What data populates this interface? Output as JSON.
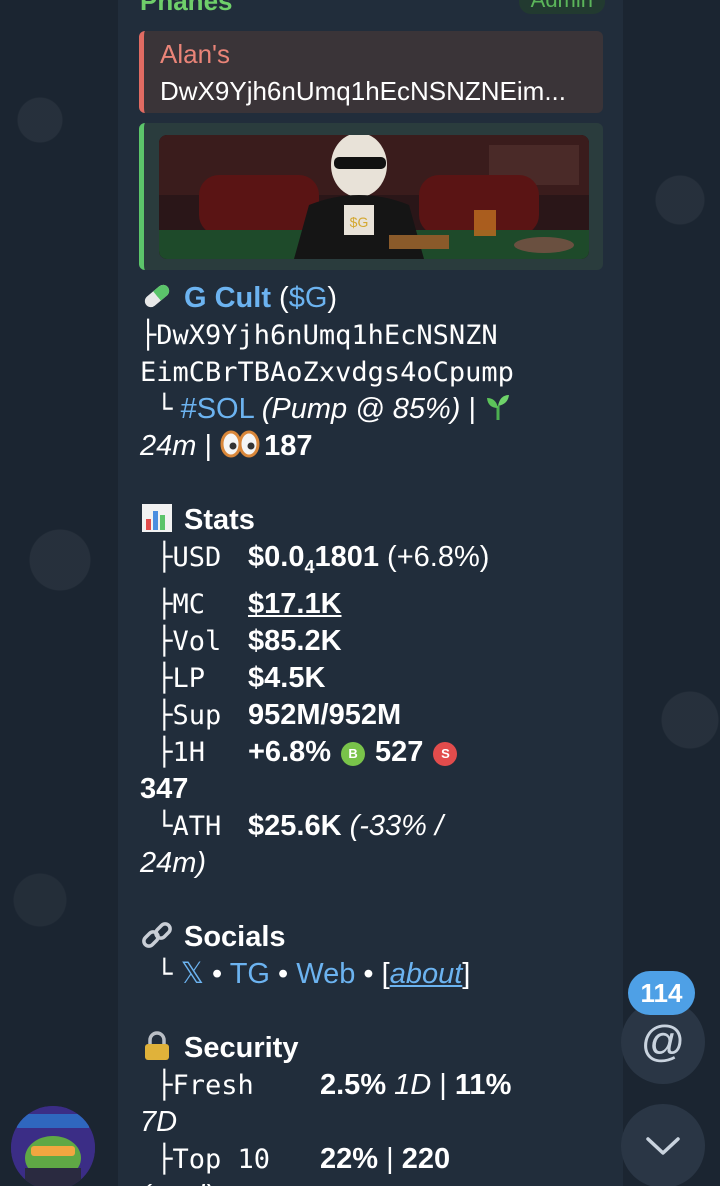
{
  "sender": {
    "name": "Phanes",
    "badge": "Admin"
  },
  "reply": {
    "name": "Alan's",
    "text": "DwX9Yjh6nUmq1hEcNSNZNEim..."
  },
  "token": {
    "name": "G Cult",
    "ticker": "$G",
    "ca_line1": "DwX9Yjh6nUmq1hEcNSNZN",
    "ca_line2": "EimCBrTBAoZxvdgs4oCpump",
    "chain": "#SOL",
    "pump_info": "(Pump @ 85%)",
    "age": "24m",
    "views": "187"
  },
  "stats": {
    "heading": "Stats",
    "usd_label": "USD",
    "usd_price_prefix": "$0.0",
    "usd_price_zeros": "4",
    "usd_price_suffix": "1801",
    "usd_change": "(+6.8%)",
    "mc_label": "MC",
    "mc_value": "$17.1K",
    "vol_label": "Vol",
    "vol_value": "$85.2K",
    "lp_label": "LP",
    "lp_value": "$4.5K",
    "sup_label": "Sup",
    "sup_value": "952M/952M",
    "h1_label": "1H",
    "h1_change": "+6.8%",
    "buy_badge": "B",
    "buys": "527",
    "sell_badge": "S",
    "sells": "347",
    "ath_label": "ATH",
    "ath_value": "$25.6K",
    "ath_detail_a": "(-33% /",
    "ath_detail_b": "24m)"
  },
  "socials": {
    "heading": "Socials",
    "x": "𝕏",
    "tg": "TG",
    "web": "Web",
    "about": "about"
  },
  "security": {
    "heading": "Security",
    "fresh_label": "Fresh",
    "fresh_pct": "2.5%",
    "fresh_1d": "1D",
    "fresh_7d_pct": "11%",
    "fresh_7d": "7D",
    "top10_label": "Top 10",
    "top10_pct": "22%",
    "top10_total": "220",
    "top10_total_label": "(total)"
  },
  "fab": {
    "mention_count": "114",
    "mention_symbol": "@"
  },
  "colors": {
    "link": "#6cb3f0",
    "bubble": "#212d3b",
    "background": "#1b2531",
    "accent": "#4ea0e6"
  },
  "icons": [
    "pill-icon",
    "chart-icon",
    "link-icon",
    "lock-icon",
    "seedling-icon",
    "eyes-icon",
    "chevron-down-icon"
  ]
}
